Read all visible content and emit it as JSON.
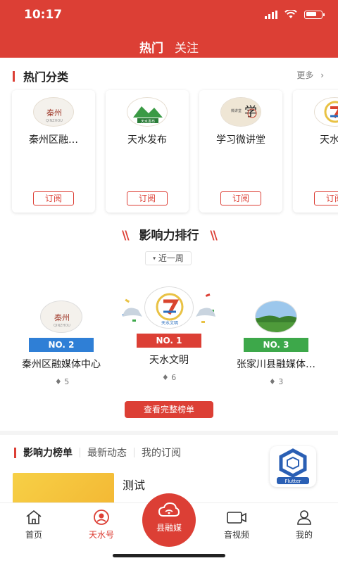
{
  "status_bar": {
    "time": "10:17"
  },
  "header": {
    "tabs": [
      {
        "label": "热门"
      },
      {
        "label": "关注"
      }
    ],
    "accent_color": "#dc3f35"
  },
  "hot_categories": {
    "title": "热门分类",
    "more_label": "更多",
    "cards": [
      {
        "name": "秦州区融…",
        "subscribe_label": "订阅"
      },
      {
        "name": "天水发布",
        "subscribe_label": "订阅"
      },
      {
        "name": "学习微讲堂",
        "subscribe_label": "订阅"
      },
      {
        "name": "天水文",
        "subscribe_label": "订阅"
      }
    ]
  },
  "influence_ranking": {
    "title": "影响力排行",
    "period": "近一周",
    "ranks": [
      {
        "badge": "NO. 2",
        "name": "秦州区融媒体中心",
        "count": "5"
      },
      {
        "badge": "NO. 1",
        "name": "天水文明",
        "count": "6"
      },
      {
        "badge": "NO. 3",
        "name": "张家川县融媒体…",
        "count": "3"
      }
    ],
    "full_list_label": "查看完整榜单"
  },
  "bottom_tabs": {
    "items": [
      {
        "label": "影响力榜单"
      },
      {
        "label": "最新动态"
      },
      {
        "label": "我的订阅"
      }
    ]
  },
  "flutter_badge": {
    "label": "Flutter"
  },
  "news": {
    "title": "测试"
  },
  "bottom_nav": {
    "items": [
      {
        "label": "首页",
        "icon": "home-icon"
      },
      {
        "label": "天水号",
        "icon": "tianshui-icon"
      },
      {
        "label": "县融媒",
        "icon": "cloud-icon"
      },
      {
        "label": "音视频",
        "icon": "video-icon"
      },
      {
        "label": "我的",
        "icon": "user-icon"
      }
    ]
  },
  "colors": {
    "rank1": "#dc3f35",
    "rank2": "#2f7fd6",
    "rank3": "#3da84a"
  }
}
